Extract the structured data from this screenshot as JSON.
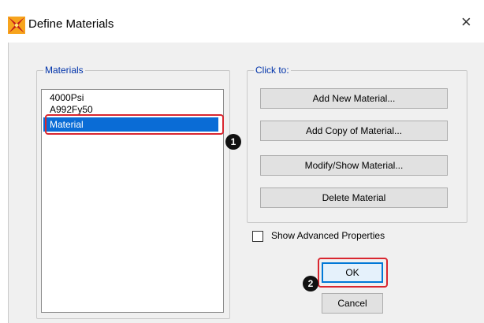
{
  "window": {
    "title": "Define Materials",
    "close_glyph": "×"
  },
  "materials_group": {
    "label": "Materials",
    "items": [
      "4000Psi",
      "A992Fy50",
      "Material"
    ],
    "selected_index": 2
  },
  "click_to_group": {
    "label": "Click to:",
    "buttons": [
      "Add New Material...",
      "Add Copy of Material...",
      "Modify/Show Material...",
      "Delete Material"
    ]
  },
  "options": {
    "show_advanced_label": "Show Advanced Properties",
    "show_advanced_checked": false
  },
  "actions": {
    "ok_label": "OK",
    "cancel_label": "Cancel"
  },
  "annotations": {
    "badge_1": "1",
    "badge_2": "2",
    "highlight_color": "#d9262f"
  },
  "colors": {
    "selection": "#0a6cd6",
    "group_label": "#0033aa",
    "default_button_border": "#0078d7"
  }
}
